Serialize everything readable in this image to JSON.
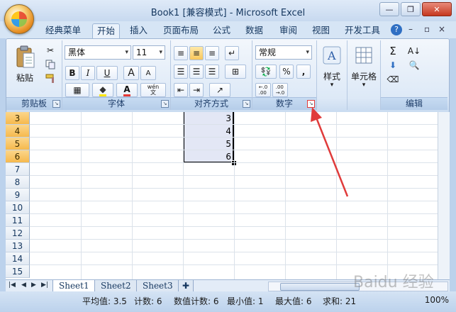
{
  "window": {
    "title": "Book1  [兼容模式] - Microsoft Excel",
    "minimize": "—",
    "restore": "❐",
    "close": "✕"
  },
  "tabs": [
    {
      "label": "经典菜单"
    },
    {
      "label": "开始"
    },
    {
      "label": "插入"
    },
    {
      "label": "页面布局"
    },
    {
      "label": "公式"
    },
    {
      "label": "数据"
    },
    {
      "label": "审阅"
    },
    {
      "label": "视图"
    },
    {
      "label": "开发工具"
    }
  ],
  "tab_controls": {
    "help": "?",
    "min": "–",
    "restore": "▫",
    "close": "×"
  },
  "ribbon": {
    "clipboard": {
      "label": "剪贴板",
      "paste": "粘贴"
    },
    "font": {
      "label": "字体",
      "name": "黑体",
      "size": "11",
      "bold": "B",
      "italic": "I",
      "underline": "U",
      "grow": "A",
      "shrink": "A",
      "phonetic": "wén\n文"
    },
    "alignment": {
      "label": "对齐方式"
    },
    "number": {
      "label": "数字",
      "format": "常规",
      "percent": "%",
      "comma": ",",
      "inc_decimal": "←.0\n.00",
      "dec_decimal": ".00\n→.0"
    },
    "styles": {
      "label": "样式"
    },
    "cells": {
      "label": "单元格"
    },
    "editing": {
      "label": "编辑",
      "sum": "Σ"
    }
  },
  "grid": {
    "rows": [
      "3",
      "4",
      "5",
      "6",
      "7",
      "8",
      "9",
      "10",
      "11",
      "12",
      "13",
      "14",
      "15"
    ],
    "selected_rows": [
      "3",
      "4",
      "5",
      "6"
    ],
    "values": [
      "3",
      "4",
      "5",
      "6"
    ]
  },
  "sheets": [
    {
      "label": "Sheet1"
    },
    {
      "label": "Sheet2"
    },
    {
      "label": "Sheet3"
    }
  ],
  "status": {
    "average": "平均值: 3.5",
    "count": "计数: 6",
    "numeric_count": "数值计数: 6",
    "min": "最小值: 1",
    "max": "最大值: 6",
    "sum": "求和: 21",
    "zoom": "100%"
  },
  "watermark": "Baidu 经验",
  "colors": {
    "accent": "#e03b3b",
    "ribbon": "#dde9f7",
    "selected_row_header": "#f6b94d"
  }
}
